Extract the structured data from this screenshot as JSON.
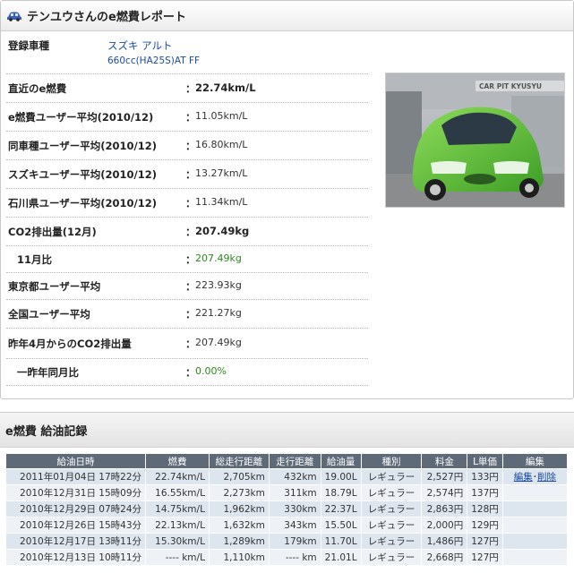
{
  "report": {
    "title": "テンユウさんのe燃費レポート",
    "car_label": "登録車種",
    "car_model_link": "スズキ アルト",
    "car_spec_link": "660cc(HA25S)AT FF",
    "stats": [
      {
        "label": "直近のe燃費",
        "value": "22.74km/L",
        "style": "bold"
      },
      {
        "label": "e燃費ユーザー平均(2010/12)",
        "value": "11.05km/L",
        "style": "normal"
      },
      {
        "label": "同車種ユーザー平均(2010/12)",
        "value": "16.80km/L",
        "style": "normal"
      },
      {
        "label": "スズキユーザー平均(2010/12)",
        "value": "13.27km/L",
        "style": "normal"
      },
      {
        "label": "石川県ユーザー平均(2010/12)",
        "value": "11.34km/L",
        "style": "normal"
      },
      {
        "label": "CO2排出量(12月)",
        "value": "207.49kg",
        "style": "bold"
      },
      {
        "label": "11月比",
        "value": "207.49kg",
        "style": "green"
      },
      {
        "label": "東京都ユーザー平均",
        "value": "223.93kg",
        "style": "normal"
      },
      {
        "label": "全国ユーザー平均",
        "value": "221.27kg",
        "style": "normal"
      },
      {
        "label": "昨年4月からのCO2排出量",
        "value": "207.49kg",
        "style": "normal"
      },
      {
        "label": "一昨年同月比",
        "value": "0.00%",
        "style": "green"
      }
    ],
    "colon": "：",
    "photo_sign": "CAR PIT KYUSYU"
  },
  "fuel": {
    "title": "e燃費 給油記録",
    "headers": [
      "給油日時",
      "燃費",
      "総走行距離",
      "走行距離",
      "給油量",
      "種別",
      "料金",
      "L単価",
      "編集"
    ],
    "rows": [
      [
        "2011年01月04日 17時22分",
        "22.74km/L",
        "2,705km",
        "432km",
        "19.00L",
        "レギュラー",
        "2,527円",
        "133円"
      ],
      [
        "2010年12月31日 15時09分",
        "16.55km/L",
        "2,273km",
        "311km",
        "18.79L",
        "レギュラー",
        "2,574円",
        "137円"
      ],
      [
        "2010年12月29日 07時24分",
        "14.75km/L",
        "1,962km",
        "330km",
        "22.37L",
        "レギュラー",
        "2,863円",
        "128円"
      ],
      [
        "2010年12月26日 15時43分",
        "22.13km/L",
        "1,632km",
        "343km",
        "15.50L",
        "レギュラー",
        "2,000円",
        "129円"
      ],
      [
        "2010年12月17日 13時11分",
        "15.30km/L",
        "1,289km",
        "179km",
        "11.70L",
        "レギュラー",
        "1,486円",
        "127円"
      ],
      [
        "2010年12月13日 10時11分",
        "---- km/L",
        "1,110km",
        "---- km",
        "21.01L",
        "レギュラー",
        "2,668円",
        "127円"
      ]
    ],
    "edit_label": "編集",
    "dot": "･",
    "delete_label": "削除"
  }
}
